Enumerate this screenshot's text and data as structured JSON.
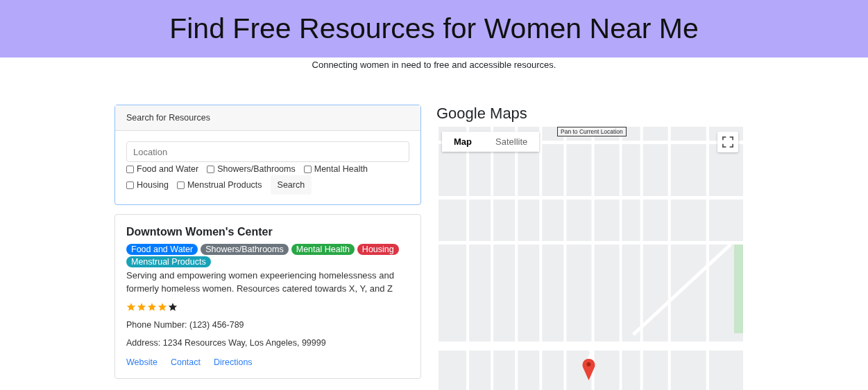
{
  "header": {
    "title": "Find Free Resources for Women Near Me",
    "subtitle": "Connecting women in need to free and accessible resources."
  },
  "search": {
    "title": "Search for Resources",
    "placeholder": "Location",
    "categories": [
      {
        "label": "Food and Water",
        "checked": false
      },
      {
        "label": "Showers/Bathrooms",
        "checked": false
      },
      {
        "label": "Mental Health",
        "checked": false
      },
      {
        "label": "Housing",
        "checked": false
      },
      {
        "label": "Menstrual Products",
        "checked": false
      }
    ],
    "button": "Search"
  },
  "results": [
    {
      "name": "Downtown Women's Center",
      "tags": [
        {
          "label": "Food and Water",
          "color": "#007bff"
        },
        {
          "label": "Showers/Bathrooms",
          "color": "#6c757d"
        },
        {
          "label": "Mental Health",
          "color": "#28a745"
        },
        {
          "label": "Housing",
          "color": "#dc3545"
        },
        {
          "label": "Menstrual Products",
          "color": "#17a2b8"
        }
      ],
      "description": "Serving and empowering women expeeriencing homelessness and formerly homeless women. Resources catered towards X, Y, and Z",
      "stars": 4,
      "phone": "Phone Number: (123) 456-789",
      "address": "Address: 1234 Resources Way, Los Angeles, 99999",
      "links": [
        "Website",
        "Contact",
        "Directions"
      ]
    }
  ],
  "map": {
    "title": "Google Maps",
    "tooltip": "Pan to Current Location",
    "tabs": [
      {
        "label": "Map",
        "selected": true
      },
      {
        "label": "Satellite",
        "selected": false
      }
    ]
  }
}
